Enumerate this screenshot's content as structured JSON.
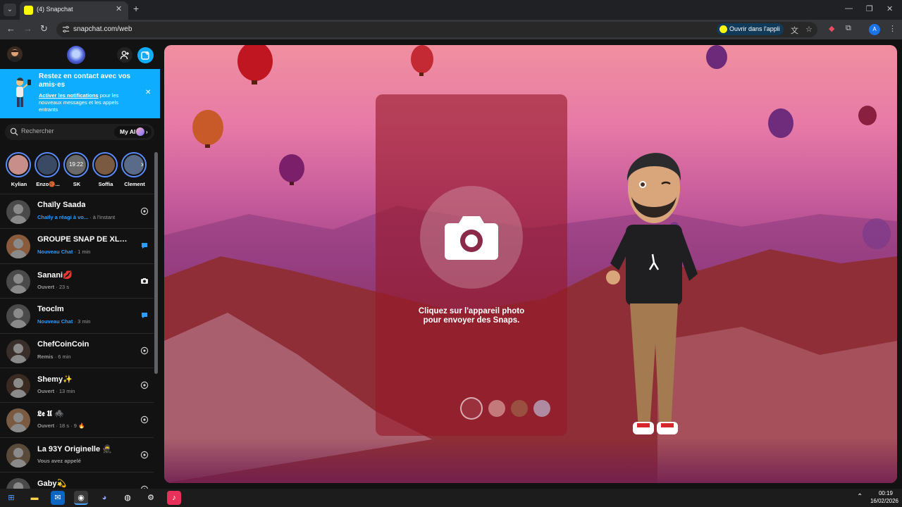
{
  "browser": {
    "tab_title": "(4) Snapchat",
    "tab_close": "✕",
    "new_tab": "+",
    "url": "snapchat.com/web",
    "open_in_app": "Ouvrir dans l'appli",
    "profile_initial": "A"
  },
  "sidebar": {
    "banner": {
      "title": "Restez en contact avec vos amis·es",
      "link": "Activer les notifications",
      "body": "pour les nouveaux messages et les appels entrants"
    },
    "search": {
      "placeholder": "Rechercher",
      "my_ai": "My AI"
    },
    "stories": [
      {
        "name": "Kylian",
        "color": "#c88f8a"
      },
      {
        "name": "Enzo🏀...",
        "color": "#3b4a64"
      },
      {
        "name": "SK",
        "color": "#6a6a6a",
        "overlay": "19:22"
      },
      {
        "name": "Soffia",
        "color": "#7a5a40"
      },
      {
        "name": "Clement",
        "color": "#5a6b8a"
      }
    ],
    "chats": [
      {
        "name": "Chaïly Saada",
        "tag": "Chaïly a réagi à vo...",
        "tag_color": "#2d9dff",
        "time": "à l'instant",
        "icon": "replay",
        "avatar": "#4a4a4a"
      },
      {
        "name": "GROUPE SNAP DE XLAS...",
        "tag": "Nouveau Chat",
        "tag_color": "#2d9dff",
        "time": "1 min",
        "icon": "chat",
        "avatar": "#8a5a3c"
      },
      {
        "name": "Sanani💋",
        "tag": "Ouvert",
        "tag_color": "#9a9a9a",
        "time": "23 s",
        "icon": "camera",
        "avatar": "#4a4a4a"
      },
      {
        "name": "Teoclm",
        "tag": "Nouveau Chat",
        "tag_color": "#2d9dff",
        "time": "3 min",
        "icon": "chat",
        "avatar": "#4a4a4a"
      },
      {
        "name": "ChefCoinCoin",
        "tag": "Remis",
        "tag_color": "#9a9a9a",
        "time": "6 min",
        "icon": "replay",
        "avatar": "#3a2e2a"
      },
      {
        "name": "Shemy✨",
        "tag": "Ouvert",
        "tag_color": "#9a9a9a",
        "time": "13 min",
        "icon": "replay",
        "avatar": "#3a2a22"
      },
      {
        "name": "𝕷𝖊 𝖀 🕷️",
        "tag": "Ouvert",
        "tag_color": "#9a9a9a",
        "time": "18 s · 9 🔥",
        "icon": "replay",
        "avatar": "#7a5a40"
      },
      {
        "name": "La 93Y Originelle 🥷",
        "tag": "Vous avez appelé",
        "tag_color": "#9a9a9a",
        "time": "",
        "icon": "replay",
        "avatar": "#5a4a3a"
      },
      {
        "name": "Gaby💫",
        "tag": "",
        "tag_color": "#9a9a9a",
        "time": "",
        "icon": "replay",
        "avatar": "#4a4a4a"
      }
    ]
  },
  "main": {
    "camera_hint": "Cliquez sur l'appareil photo pour envoyer des Snaps."
  },
  "taskbar": {
    "time": "00:19",
    "date": "16/02/2026"
  }
}
